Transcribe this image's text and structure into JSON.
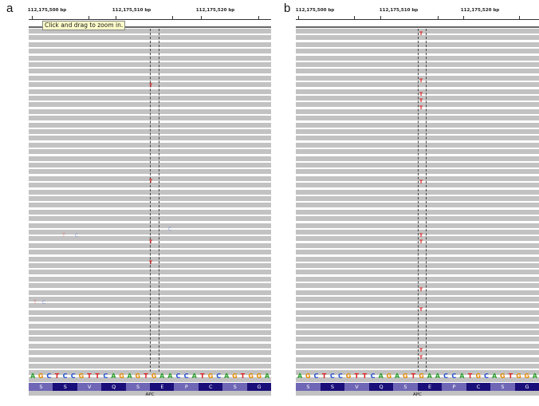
{
  "panels": [
    {
      "id": "a",
      "letter": "a",
      "ruler_labels": [
        "112,175,500 bp",
        "112,175,510 bp",
        "112,175,520 bp"
      ],
      "tooltip": "Click and drag to zoom in.",
      "sequence": "AGCTCCGTTCAGAGTGAACCATGCAGTGGA",
      "amino_acids": [
        "S",
        "S",
        "V",
        "Q",
        "S",
        "E",
        "P",
        "C",
        "S",
        "G"
      ],
      "gene": "APC",
      "mismatches": [
        "T",
        "T",
        "T",
        "T",
        "T",
        "C",
        "T",
        "C",
        "C"
      ]
    },
    {
      "id": "b",
      "letter": "b",
      "ruler_labels": [
        "112,175,500 bp",
        "112,175,510 bp",
        "112,175,520 bp"
      ],
      "sequence": "AGCTCCGTTCAGAGTGAACCATGCAGTGGA",
      "amino_acids": [
        "S",
        "S",
        "V",
        "Q",
        "S",
        "E",
        "P",
        "C",
        "S",
        "G"
      ],
      "gene": "APC",
      "mismatches": [
        "T",
        "T",
        "T",
        "T",
        "T",
        "T",
        "T",
        "T",
        "T",
        "T",
        "T",
        "T"
      ]
    }
  ],
  "colors": {
    "A": "#2ca02c",
    "C": "#1f4fd6",
    "G": "#e88a00",
    "T": "#e02020",
    "read": "#c2c2c2",
    "aa_dark": "#1a0f7a",
    "aa_light": "#6f66b5"
  }
}
